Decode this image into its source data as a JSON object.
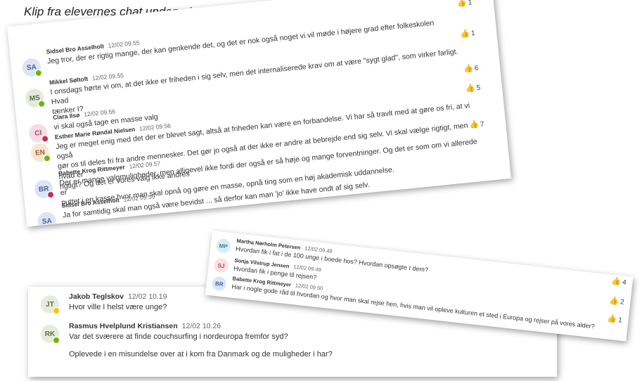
{
  "heading": "Klip fra elevernes chat undervejs:",
  "thumb_icon": "thumbs-up-icon",
  "colors": {
    "online": "#6bb700",
    "away": "#f8c400",
    "busy": "#c4314b",
    "reaction": "#e8a93a"
  },
  "card1": {
    "top_reaction": "1",
    "messages": [
      {
        "initials": "SA",
        "author": "Sidsel Bro Asselholt",
        "time": "12/02 09.55",
        "text": [
          "Jeg tror, der er rigtig mange, der kan genkende det, og det er nok også noget vi vil møde i højere grad efter folkeskolen"
        ],
        "reaction": "1",
        "status": "online",
        "avatar_bg": "#dbe5f5",
        "avatar_fg": "#4a5fa5"
      },
      {
        "initials": "MS",
        "author": "Mikkel Søltoft",
        "time": "12/02 09.55",
        "text": [
          "I onsdags hørte vi om, at det ikke er friheden i sig selv, men det internaliserede krav om at være \"sygt glad\", som virker farligt. Hvad",
          "tænker I?"
        ],
        "reaction": "1",
        "status": "online",
        "avatar_bg": "#e3ead9",
        "avatar_fg": "#566b3c"
      },
      {
        "initials": "CI",
        "author": "Clara Ilsø",
        "time": "12/02 09.56",
        "text": [
          "vi skal også tage en masse valg"
        ],
        "reaction": "6",
        "status": "busy",
        "avatar_bg": "#f4dce6",
        "avatar_fg": "#a8476f"
      },
      {
        "initials": "EN",
        "author": "Esther Marie Røndal Nielsen",
        "time": "12/02 09.56",
        "text": [
          "Jeg er meget enig med det der er blevet sagt, altså at friheden kan være en forbandelse. Vi har så travlt med at gøre os fri, at vi også",
          "gør os til deles fri fra andre mennesker. Det gør jo også at der ikke er andre at bebrejde end sig selv. Vi skal vælge rigtigt, men hvad er",
          "rigtigt? Og det er vores valg ikke andres"
        ],
        "reaction": "5",
        "status": "online",
        "avatar_bg": "#f5e6d8",
        "avatar_fg": "#9c6434"
      },
      {
        "initials": "BR",
        "author": "Babette Krog Rittmeyer",
        "time": "12/02 09.57",
        "text": [
          "Der er mange valgmuligheder, men alligevel ikke fordi der også er så høje og mange forventninger. Og det er som om vi allerede er",
          "puttet i en kasse hvor man skal opnå og gøre en masse, opnå ting som en høj akademisk uddannelse."
        ],
        "reaction": "7",
        "status": "busy",
        "avatar_bg": "#dbe5f5",
        "avatar_fg": "#4a5fa5"
      },
      {
        "initials": "SA",
        "author": "Sidsel Bro Asselholt",
        "time": "12/02 09.59",
        "text": [
          "Ja for samtidig skal man også være bevidst ... så derfor kan man 'jo' ikke have ondt af sig selv."
        ],
        "reaction": "",
        "status": "online",
        "avatar_bg": "#dbe5f5",
        "avatar_fg": "#4a5fa5"
      }
    ]
  },
  "card2": {
    "messages": [
      {
        "initials": "MP",
        "author": "Martha Nørholm Petersen",
        "time": "12/02 09.48",
        "text": [
          "Hvordan fik i fat i de 100 unge i boede hos? Hvordan opsøgte I dem?"
        ],
        "reaction": "4",
        "status": "",
        "avatar_bg": "#d8eef3",
        "avatar_fg": "#3a7f8f"
      },
      {
        "initials": "SJ",
        "author": "Sonja Vilstrup Jensen",
        "time": "12/02 09.49",
        "text": [
          "Hvordan fik i penge til rejsen?"
        ],
        "reaction": "2",
        "status": "",
        "avatar_bg": "#f9dfe0",
        "avatar_fg": "#b04a50"
      },
      {
        "initials": "BR",
        "author": "Babette Krog Rittmeyer",
        "time": "12/02 09.50",
        "text": [
          "Har i nogle gode råd til hvordan og hvor man skal rejse hen, hvis man vil opleve kulturen et sted i Europa og rejser på vores alder?"
        ],
        "reaction": "1",
        "status": "",
        "avatar_bg": "#dbe5f5",
        "avatar_fg": "#4a5fa5"
      }
    ]
  },
  "card3": {
    "messages": [
      {
        "initials": "JT",
        "author": "Jakob Teglskov",
        "time": "12/02 10.19",
        "text": [
          "Hvor ville I helst være unge?"
        ],
        "status": "away",
        "avatar_bg": "#e6ecdc",
        "avatar_fg": "#5c7040"
      },
      {
        "initials": "RK",
        "author": "Rasmus Hvelplund Kristiansen",
        "time": "12/02 10.26",
        "text": [
          "Var det sværere at finde couchsurfing i nordeuropa fremfor syd?",
          "",
          "Oplevede i en misundelse over at i kom fra Danmark og de muligheder i har?"
        ],
        "status": "online",
        "avatar_bg": "#e6ecdc",
        "avatar_fg": "#5c7040"
      }
    ]
  }
}
